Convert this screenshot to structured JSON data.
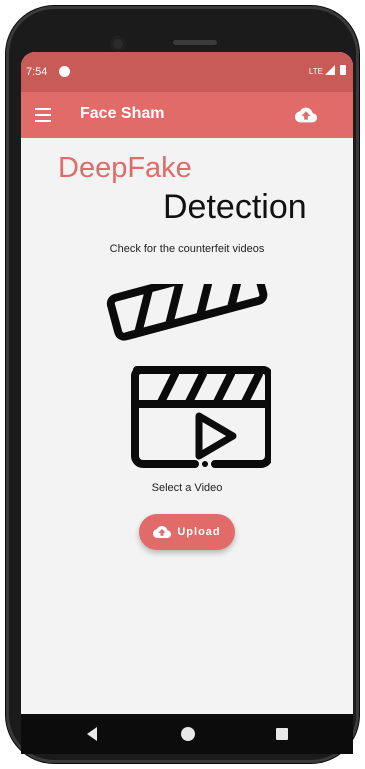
{
  "status_bar": {
    "time": "7:54",
    "network": "LTE"
  },
  "app_bar": {
    "title": "Face Sham",
    "menu_icon": "menu-icon",
    "upload_icon": "cloud-upload-icon"
  },
  "main": {
    "heading_primary": "DeepFake",
    "heading_secondary": "Detection",
    "subtitle": "Check for the counterfeit videos",
    "illustration_icon": "clapperboard-icon",
    "select_label": "Select a Video",
    "upload_button": {
      "label": "Upload",
      "icon": "cloud-upload-icon"
    }
  },
  "nav_bar": {
    "back": "back-icon",
    "home": "home-icon",
    "recents": "recents-icon"
  },
  "colors": {
    "accent": "#e06b69",
    "status_bar": "#c85a58",
    "background": "#f3f3f3"
  }
}
